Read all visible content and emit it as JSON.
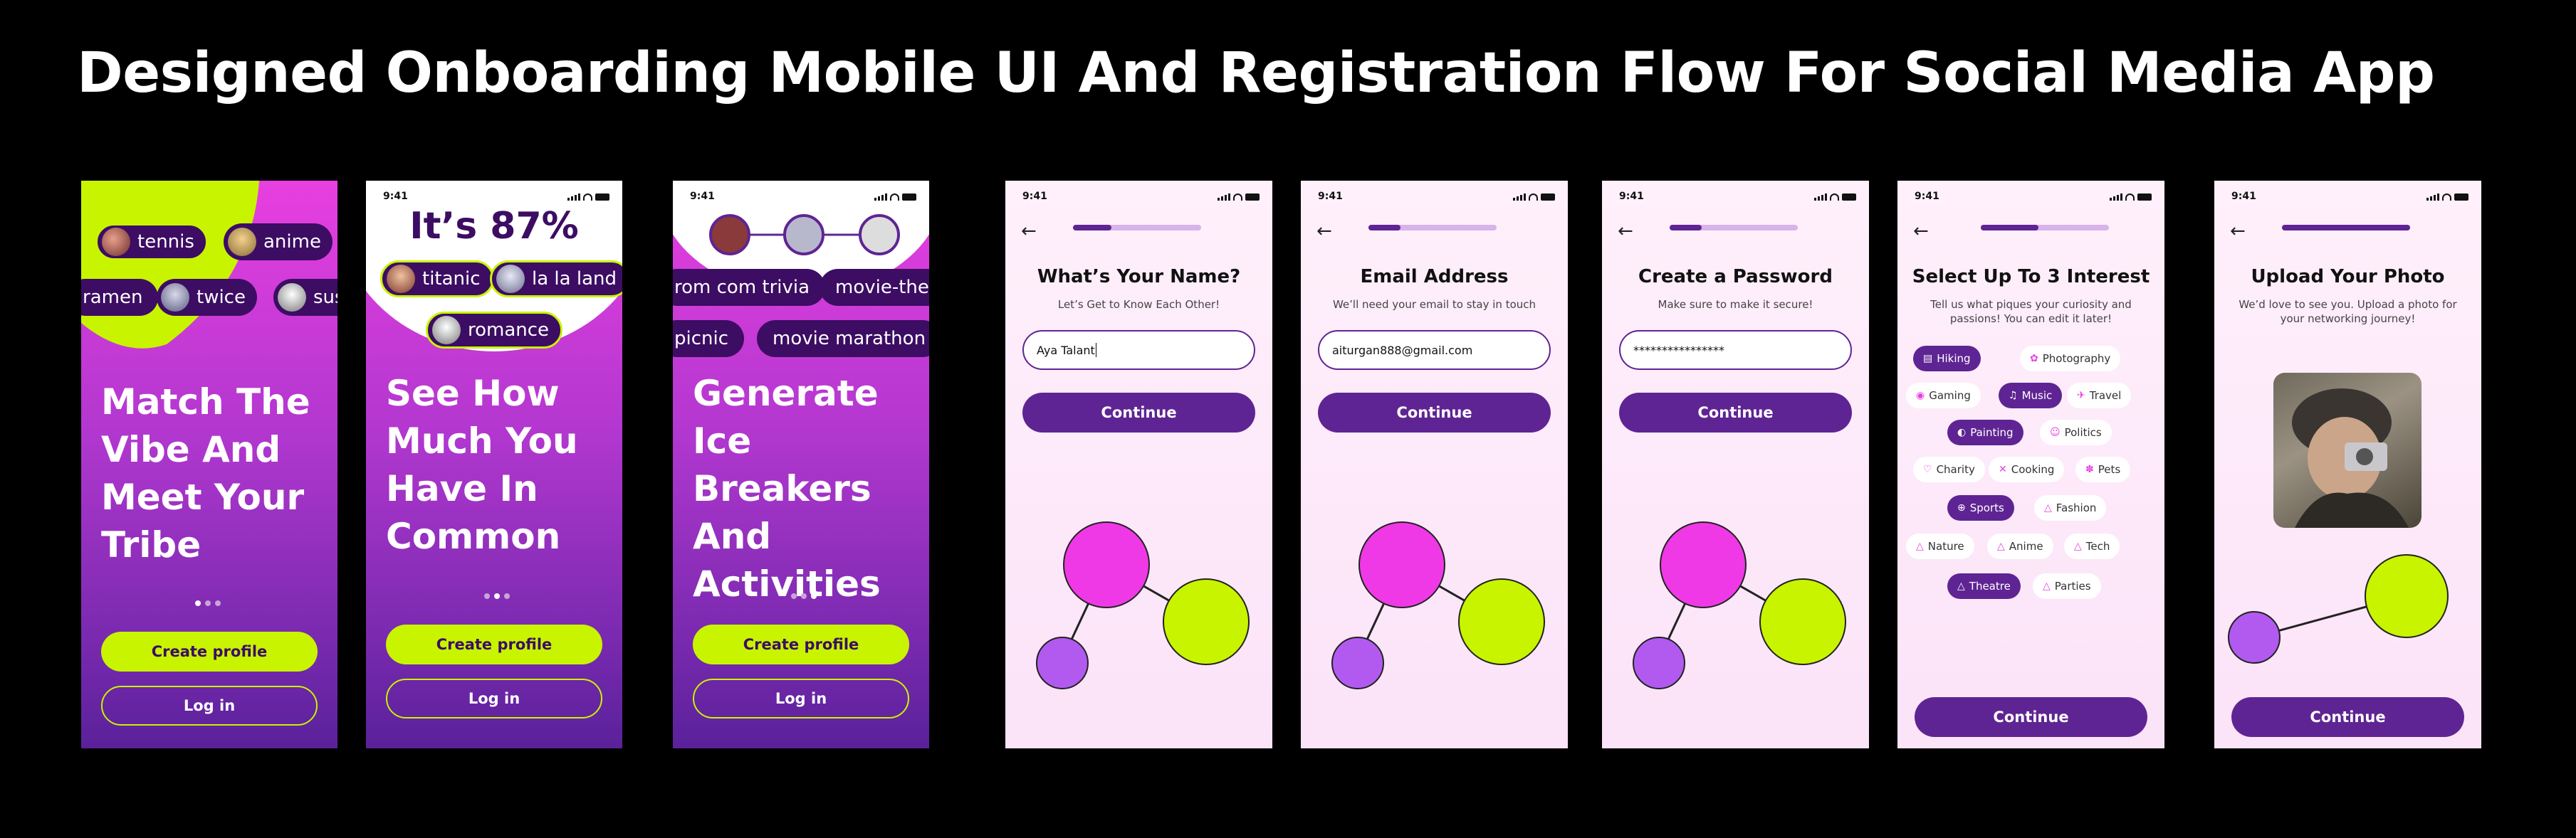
{
  "title": "Designed Onboarding Mobile UI And Registration Flow For Social Media App",
  "status_time": "9:41",
  "colors": {
    "purple": "#5f2493",
    "lime": "#c8f400",
    "magenta": "#e83fe0",
    "dark_pill": "#3c0d63"
  },
  "screen1": {
    "pills": [
      "tennis",
      "anime",
      "ramen",
      "twice",
      "sus"
    ],
    "headline": [
      "Match The",
      "Vibe And",
      "Meet Your",
      "Tribe"
    ],
    "create_label": "Create profile",
    "login_label": "Log in"
  },
  "screen2": {
    "stat": "It’s 87%",
    "pills": [
      "titanic",
      "la la land",
      "romance"
    ],
    "headline": [
      "See How",
      "Much You",
      "Have In",
      "Common"
    ],
    "create_label": "Create profile",
    "login_label": "Log in"
  },
  "screen3": {
    "pills": [
      "rom com trivia",
      "movie-ther",
      "picnic",
      "movie marathon"
    ],
    "headline": [
      "Generate",
      "Ice Breakers",
      "And",
      "Activities"
    ],
    "create_label": "Create profile",
    "login_label": "Log in"
  },
  "name_screen": {
    "progress": 0.3,
    "title": "What’s Your Name?",
    "subtitle": "Let’s Get to Know Each Other!",
    "value": "Aya Talant",
    "button": "Continue"
  },
  "email_screen": {
    "progress": 0.25,
    "title": "Email Address",
    "subtitle": "We’ll need your email to stay in touch",
    "value": "aiturgan888@gmail.com",
    "button": "Continue"
  },
  "password_screen": {
    "progress": 0.25,
    "title": "Create a Password",
    "subtitle": "Make sure to make it secure!",
    "value": "****************",
    "button": "Continue"
  },
  "interest_screen": {
    "progress": 0.45,
    "title": "Select Up To 3 Interest",
    "subtitle": "Tell us what piques your curiosity and passions! You can edit it later!",
    "chips": [
      {
        "label": "Hiking",
        "icon": "book-icon",
        "selected": true
      },
      {
        "label": "Photography",
        "icon": "aperture-icon",
        "selected": false
      },
      {
        "label": "Gaming",
        "icon": "gamepad-icon",
        "selected": false
      },
      {
        "label": "Music",
        "icon": "music-note-icon",
        "selected": true
      },
      {
        "label": "Travel",
        "icon": "plane-icon",
        "selected": false
      },
      {
        "label": "Painting",
        "icon": "palette-icon",
        "selected": true
      },
      {
        "label": "Politics",
        "icon": "people-icon",
        "selected": false
      },
      {
        "label": "Charity",
        "icon": "hand-heart-icon",
        "selected": false
      },
      {
        "label": "Cooking",
        "icon": "utensils-icon",
        "selected": false
      },
      {
        "label": "Pets",
        "icon": "paw-icon",
        "selected": false
      },
      {
        "label": "Sports",
        "icon": "ball-icon",
        "selected": true
      },
      {
        "label": "Fashion",
        "icon": "hanger-icon",
        "selected": false
      },
      {
        "label": "Nature",
        "icon": "hanger-icon",
        "selected": false
      },
      {
        "label": "Anime",
        "icon": "hanger-icon",
        "selected": false
      },
      {
        "label": "Tech",
        "icon": "hanger-icon",
        "selected": false
      },
      {
        "label": "Theatre",
        "icon": "hanger-icon",
        "selected": true
      },
      {
        "label": "Parties",
        "icon": "hanger-icon",
        "selected": false
      }
    ],
    "button": "Continue"
  },
  "photo_screen": {
    "progress": 1.0,
    "title": "Upload Your Photo",
    "subtitle": "We’d love to see you. Upload a photo for your networking journey!",
    "button": "Continue"
  }
}
